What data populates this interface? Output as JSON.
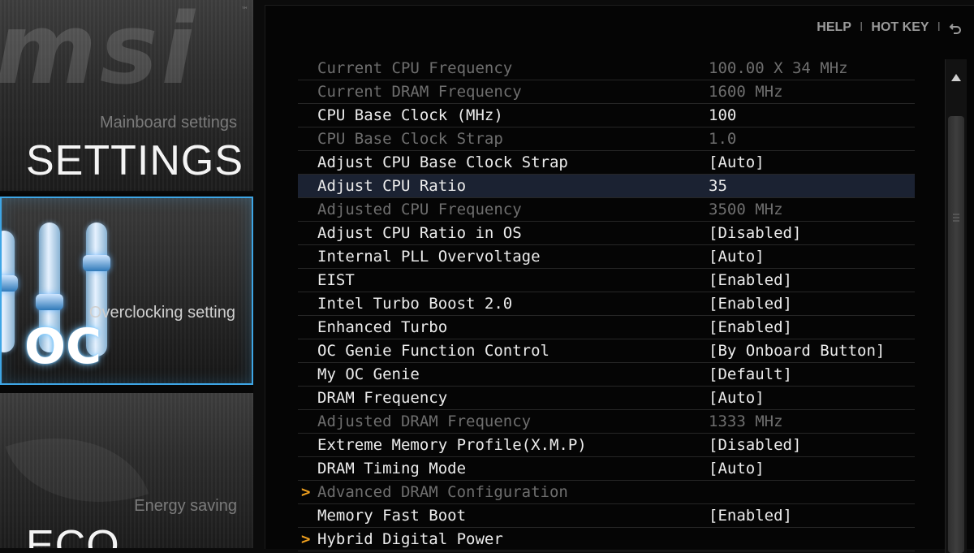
{
  "sidebar": {
    "logo_text": "msi",
    "tiles": [
      {
        "subtitle": "Mainboard settings",
        "title": "SETTINGS"
      },
      {
        "subtitle": "Overclocking setting",
        "title": "OC"
      },
      {
        "subtitle": "Energy saving",
        "title": "ECO"
      }
    ]
  },
  "topbar": {
    "help": "HELP",
    "separator": "I",
    "hotkey": "HOT KEY",
    "back_icon": "back-arrow-icon"
  },
  "colors": {
    "accent_blue": "#3ea6e6",
    "submenu_arrow": "#f0a01e",
    "selected_row": "#1b2232"
  },
  "settings": [
    {
      "label": "Current CPU Frequency",
      "value": "100.00 X 34 MHz",
      "state": "dim"
    },
    {
      "label": "Current DRAM Frequency",
      "value": "1600 MHz",
      "state": "dim"
    },
    {
      "label": "CPU Base Clock (MHz)",
      "value": "100",
      "state": "normal"
    },
    {
      "label": "CPU Base Clock Strap",
      "value": "1.0",
      "state": "dim"
    },
    {
      "label": "Adjust CPU Base Clock Strap",
      "value": "[Auto]",
      "state": "normal"
    },
    {
      "label": "Adjust CPU Ratio",
      "value": "35",
      "state": "selected"
    },
    {
      "label": "Adjusted CPU Frequency",
      "value": "3500 MHz",
      "state": "dim"
    },
    {
      "label": "Adjust CPU Ratio in OS",
      "value": "[Disabled]",
      "state": "normal"
    },
    {
      "label": "Internal PLL Overvoltage",
      "value": "[Auto]",
      "state": "normal"
    },
    {
      "label": "EIST",
      "value": "[Enabled]",
      "state": "normal"
    },
    {
      "label": "Intel Turbo Boost 2.0",
      "value": "[Enabled]",
      "state": "normal"
    },
    {
      "label": "Enhanced Turbo",
      "value": "[Enabled]",
      "state": "normal"
    },
    {
      "label": "OC Genie Function Control",
      "value": "[By Onboard Button]",
      "state": "normal"
    },
    {
      "label": "My OC Genie",
      "value": "[Default]",
      "state": "normal"
    },
    {
      "label": "DRAM Frequency",
      "value": "[Auto]",
      "state": "normal"
    },
    {
      "label": "Adjusted DRAM Frequency",
      "value": "1333 MHz",
      "state": "dim"
    },
    {
      "label": "Extreme Memory Profile(X.M.P)",
      "value": "[Disabled]",
      "state": "normal"
    },
    {
      "label": "DRAM Timing Mode",
      "value": "[Auto]",
      "state": "normal"
    },
    {
      "label": "Advanced DRAM Configuration",
      "value": "",
      "state": "dim-submenu"
    },
    {
      "label": "Memory Fast Boot",
      "value": "[Enabled]",
      "state": "normal"
    },
    {
      "label": "Hybrid Digital Power",
      "value": "",
      "state": "submenu"
    }
  ],
  "submenu_arrow_glyph": ">"
}
